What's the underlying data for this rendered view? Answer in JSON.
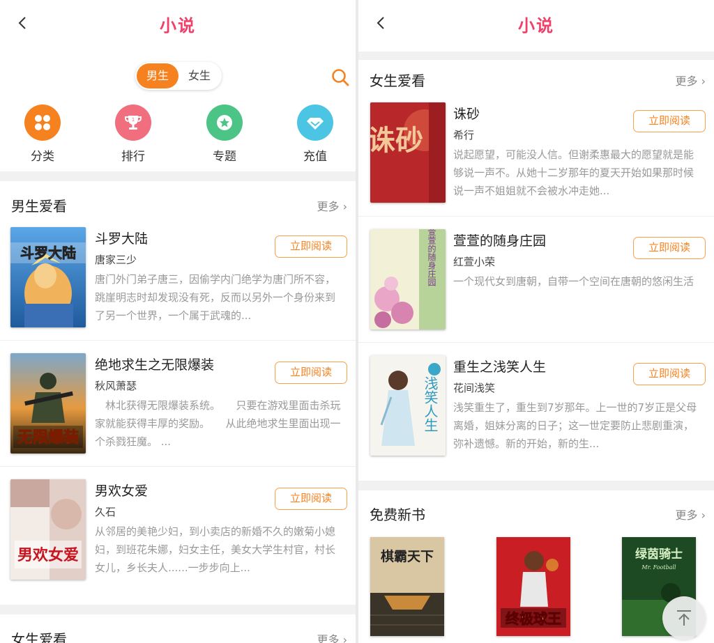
{
  "title": "小说",
  "gender_tabs": [
    {
      "label": "男生",
      "active": true
    },
    {
      "label": "女生",
      "active": false
    }
  ],
  "categories": [
    {
      "label": "分类",
      "icon": "grid-icon",
      "color": "#f6821f"
    },
    {
      "label": "排行",
      "icon": "trophy-icon",
      "color": "#f06e7e"
    },
    {
      "label": "专题",
      "icon": "star-badge-icon",
      "color": "#4cc486"
    },
    {
      "label": "充值",
      "icon": "diamond-icon",
      "color": "#4cc5e4"
    }
  ],
  "more_label": "更多",
  "read_label": "立即阅读",
  "male_section": {
    "title": "男生爱看",
    "books": [
      {
        "name": "斗罗大陆",
        "author": "唐家三少",
        "desc": "唐门外门弟子唐三，因偷学内门绝学为唐门所不容，跳崖明志时却发现没有死，反而以另外一个身份来到了另一个世界，一个属于武魂的...",
        "cover_title": "斗罗大陆"
      },
      {
        "name": "绝地求生之无限爆装",
        "author": "秋风萧瑟",
        "desc": "　林北获得无限爆装系统。　　只要在游戏里面击杀玩家就能获得丰厚的奖励。　　从此绝地求生里面出现一个杀戮狂魔。 ...",
        "cover_title": "无限爆装"
      },
      {
        "name": "男欢女爱",
        "author": "久石",
        "desc": "从邻居的美艳少妇，到小卖店的新婚不久的嫩菊小媳妇，到班花朱娜，妇女主任，美女大学生村官，村长女儿，乡长夫人......一步步向上...",
        "cover_title": "男欢女爱"
      }
    ]
  },
  "female_section_left": {
    "title": "女生爱看"
  },
  "female_section": {
    "title": "女生爱看",
    "books": [
      {
        "name": "诛砂",
        "author": "希行",
        "desc": "说起愿望，可能没人信。但谢柔惠最大的愿望就是能够说一声不。从她十二岁那年的夏天开始如果那时候说一声不姐姐就不会被水冲走她...",
        "cover_title": "诛砂"
      },
      {
        "name": "萱萱的随身庄园",
        "author": "红萱小荣",
        "desc": "一个现代女到唐朝，自带一个空间在唐朝的悠闲生活",
        "cover_title": "萱萱的随身庄园"
      },
      {
        "name": "重生之浅笑人生",
        "author": "花间浅笑",
        "desc": "浅笑重生了，重生到7岁那年。上一世的7岁正是父母离婚，姐妹分离的日子；这一世定要防止悲剧重演，弥补遗憾。新的开始，新的生...",
        "cover_title": "浅笑人生"
      }
    ]
  },
  "free_section": {
    "title": "免费新书",
    "books": [
      {
        "cover_title": "棋霸天下"
      },
      {
        "cover_title": "终极球王"
      },
      {
        "cover_title": "绿茵骑士",
        "cover_sub": "Mr. Football"
      }
    ]
  },
  "colors": {
    "title": "#f0406a",
    "accent": "#f6821f"
  }
}
